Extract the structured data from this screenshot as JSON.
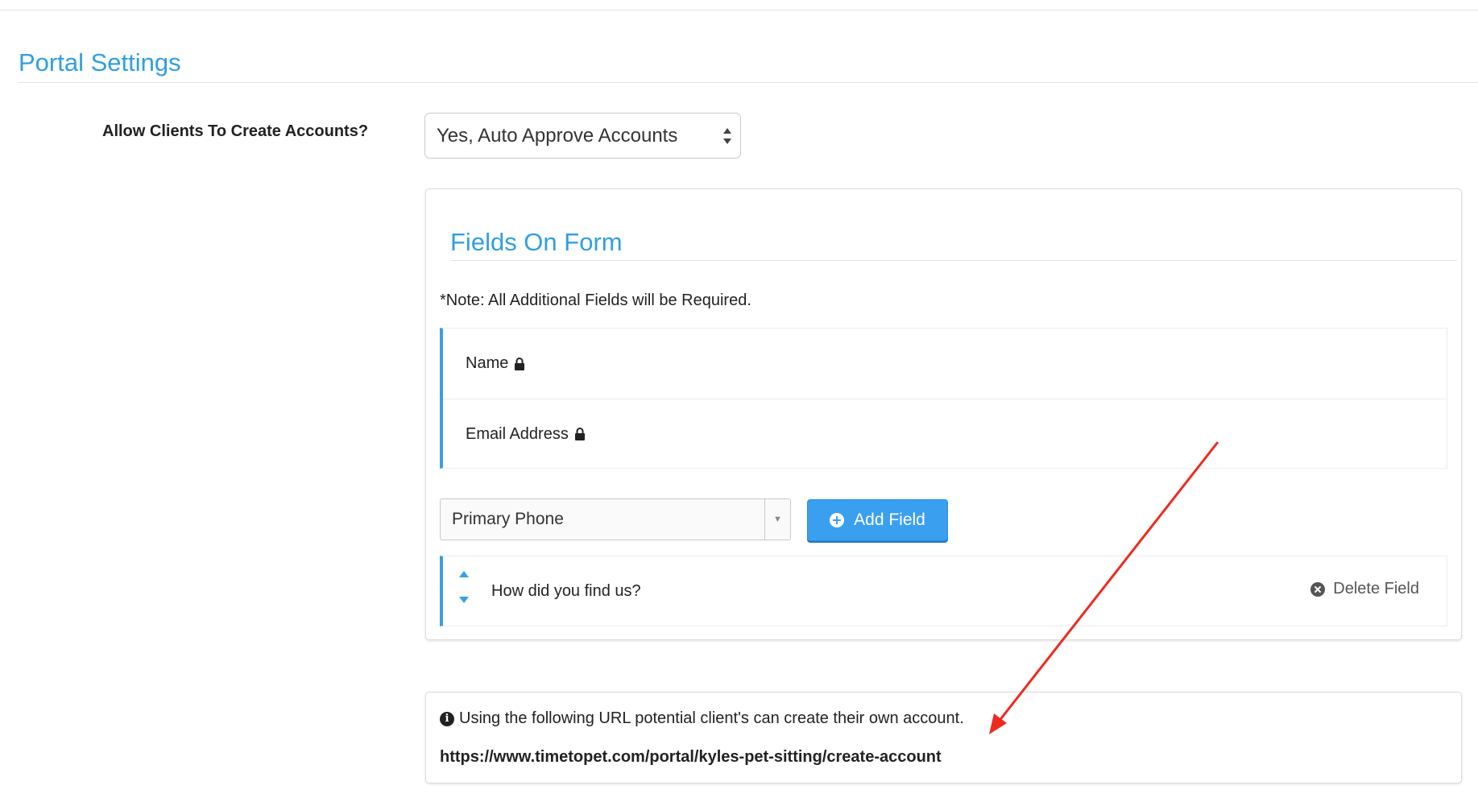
{
  "page": {
    "section_title": "Portal Settings"
  },
  "account_creation": {
    "label": "Allow Clients To Create Accounts?",
    "selected_option": "Yes, Auto Approve Accounts"
  },
  "fields_panel": {
    "title": "Fields On Form",
    "note": "*Note: All Additional Fields will be Required.",
    "locked_fields": [
      {
        "label": "Name",
        "icon": "lock-icon"
      },
      {
        "label": "Email Address",
        "icon": "lock-icon"
      }
    ],
    "add_field_select": {
      "selected": "Primary Phone"
    },
    "add_field_button": {
      "label": "Add Field",
      "icon": "plus-circle-icon"
    },
    "custom_fields": [
      {
        "label": "How did you find us?",
        "delete_label": "Delete Field",
        "delete_icon": "times-circle-icon"
      }
    ]
  },
  "info_panel": {
    "icon": "info-circle-icon",
    "message": "Using the following URL potential client's can create their own account.",
    "url": "https://www.timetopet.com/portal/kyles-pet-sitting/create-account"
  },
  "colors": {
    "accent": "#2f9fe0",
    "button": "#3b9ff0",
    "row_border": "#3a9ee4",
    "annotation_arrow": "#ee2a1e"
  }
}
